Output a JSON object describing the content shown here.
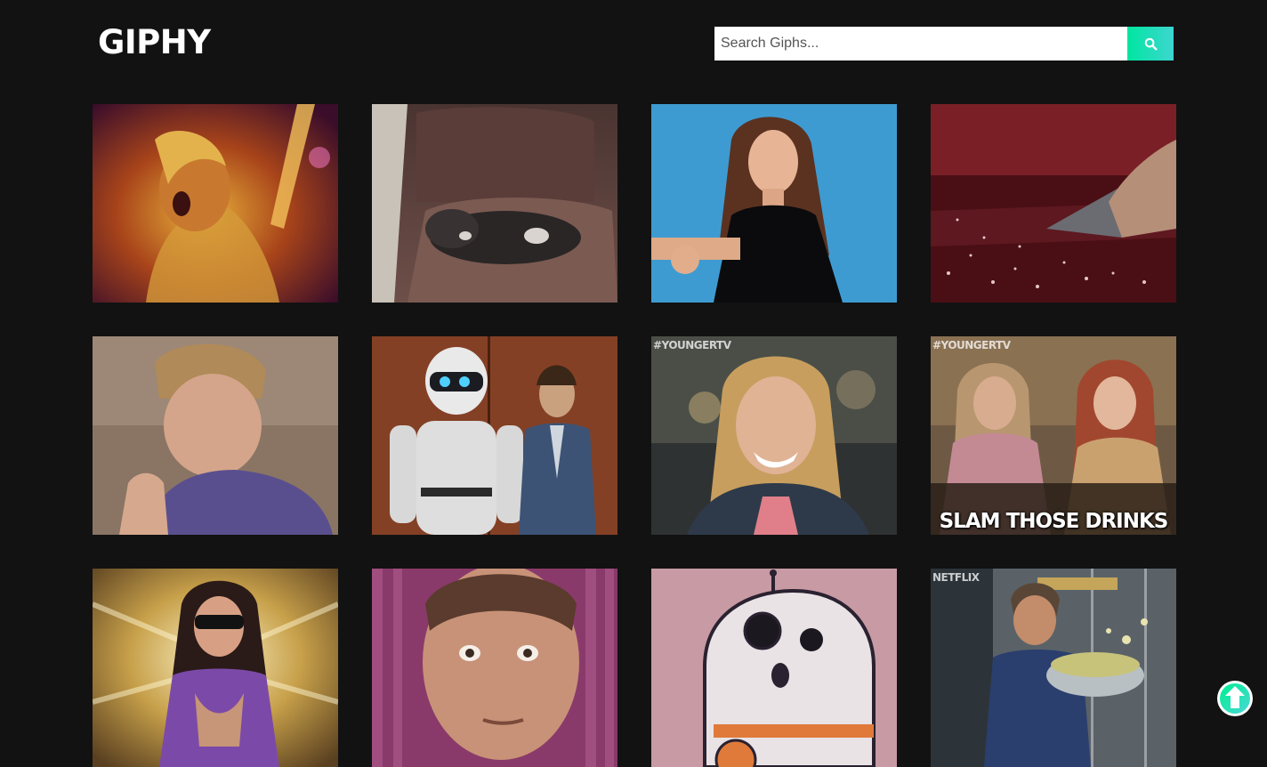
{
  "header": {
    "logo": "GIPHY",
    "search": {
      "placeholder": "Search Giphs...",
      "value": "",
      "button_icon": "search-icon",
      "button_color": "#00e6a0"
    }
  },
  "gifs": [
    {
      "scene": "party-dancer",
      "tag": "",
      "caption": ""
    },
    {
      "scene": "dog-on-leather-couch",
      "tag": "",
      "caption": ""
    },
    {
      "scene": "woman-blue-backdrop",
      "tag": "",
      "caption": ""
    },
    {
      "scene": "shark-fin-red-water",
      "tag": "",
      "caption": ""
    },
    {
      "scene": "young-man-purple-jacket",
      "tag": "",
      "caption": ""
    },
    {
      "scene": "robot-and-man-elevator",
      "tag": "",
      "caption": ""
    },
    {
      "scene": "smiling-blonde-woman",
      "tag": "#YOUNGERTV",
      "caption": ""
    },
    {
      "scene": "two-women-drinks",
      "tag": "#YOUNGERTV",
      "caption": "SLAM THOSE DRINKS"
    },
    {
      "scene": "woman-sunglasses-lights",
      "tag": "",
      "caption": ""
    },
    {
      "scene": "man-pink-curtain",
      "tag": "",
      "caption": ""
    },
    {
      "scene": "cartoon-droid",
      "tag": "",
      "caption": ""
    },
    {
      "scene": "chef-tossing-salad",
      "tag": "NETFLIX",
      "caption": ""
    }
  ],
  "scroll_top": {
    "icon": "arrow-up-circle-icon",
    "color": "#2ee8a6"
  }
}
